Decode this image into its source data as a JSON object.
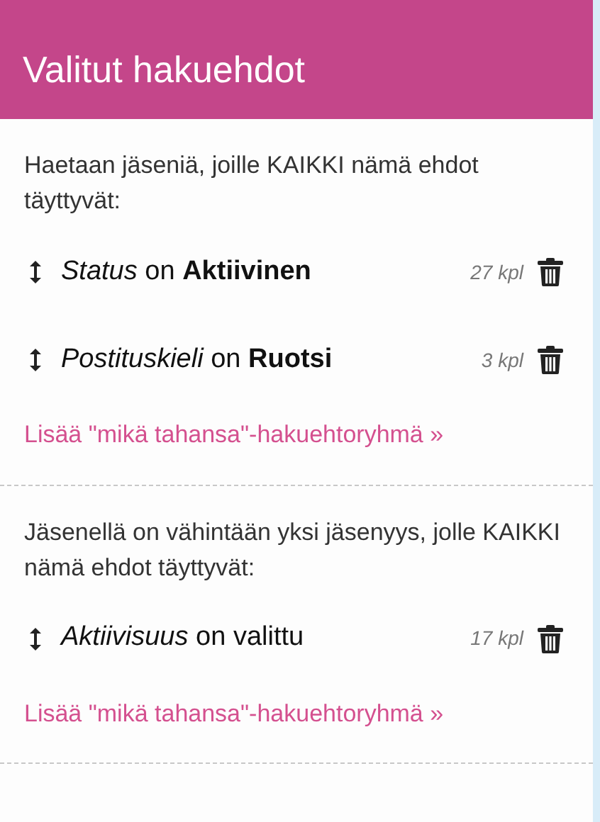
{
  "header": {
    "title": "Valitut hakuehdot"
  },
  "groups": [
    {
      "description": "Haetaan jäseniä, joille KAIKKI nämä ehdot täyttyvät:",
      "conditions": [
        {
          "text": "*Status* on **Aktiivinen**",
          "count": "27 kpl"
        },
        {
          "text": "*Postituskieli* on **Ruotsi**",
          "count": "3 kpl"
        }
      ],
      "link": "Lisää \"mikä tahansa\"-hakuehtoryhmä »"
    },
    {
      "description": "Jäsenellä on vähintään yksi jäsenyys, jolle KAIKKI nämä ehdot täyttyvät:",
      "conditions": [
        {
          "text": "*Aktiivisuus* on valittu",
          "count": "17 kpl"
        }
      ],
      "link": "Lisää \"mikä tahansa\"-hakuehtoryhmä »"
    }
  ]
}
